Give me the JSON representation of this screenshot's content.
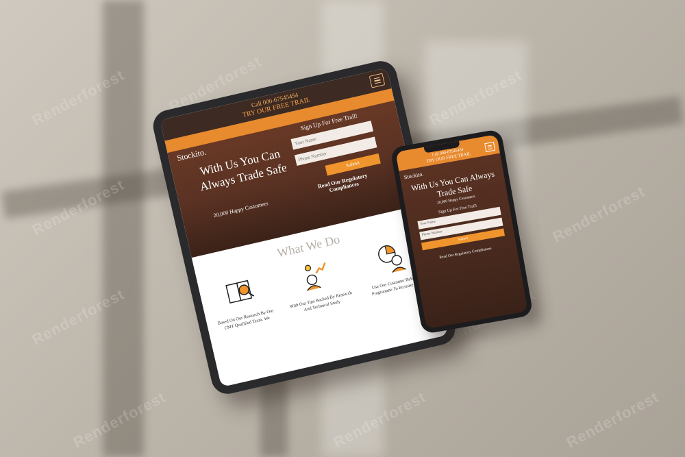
{
  "watermark": "Renderforest",
  "tablet": {
    "call_text": "Call 000-67545454",
    "try_text": "TRY OUR FREE TRAIL",
    "logo": "Stockito.",
    "headline": "With Us You Can Always Trade Safe",
    "happy": "20,000 Happy Customers",
    "form_title": "Sign Up For Free Trail!",
    "name_placeholder": "Your Name",
    "phone_placeholder": "Phone Number",
    "submit_label": "Submit",
    "regulatory": "Read Our Regulatory Compliances",
    "what_we_do": "What We Do",
    "features": [
      {
        "icon": "research-book-icon",
        "text": "Based On Our Research By Our CMT Qualified Team. We"
      },
      {
        "icon": "growth-chart-icon",
        "text": "With Our Tips Backed By Research And Technical Study"
      },
      {
        "icon": "support-agent-icon",
        "text": "Use Our Customer Referral Programme To Increase Your"
      }
    ]
  },
  "phone": {
    "call_text": "Call 000-67545454",
    "try_text": "TRY OUR FREE TRAIL",
    "logo": "Stockito.",
    "headline": "With Us You Can Always Trade Safe",
    "happy": "20,000 Happy Customers",
    "form_title": "Sign Up For Free Trail!",
    "name_placeholder": "Your Name",
    "phone_placeholder": "Phone Number",
    "submit_label": "Submit",
    "regulatory": "Read Our Regulatory Compliances"
  },
  "colors": {
    "accent": "#e88a2e",
    "dark_brown": "#3d2a22",
    "hero_brown": "#5e3424"
  }
}
